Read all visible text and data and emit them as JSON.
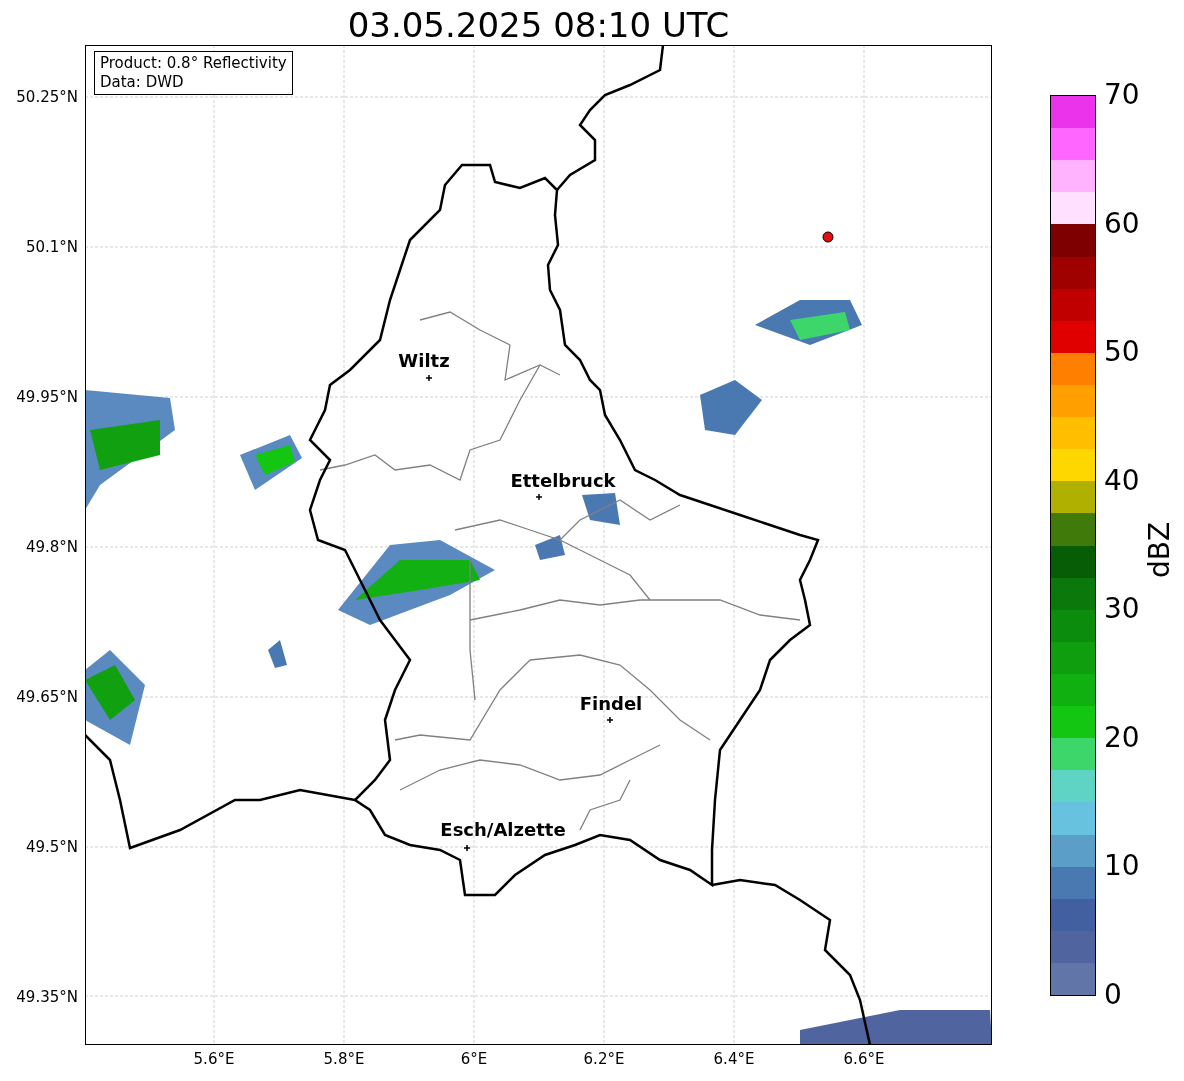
{
  "title": "03.05.2025 08:10 UTC",
  "info_box": [
    "Product: 0.8° Reflectivity",
    "Data: DWD"
  ],
  "y_ticks": [
    "50.25°N",
    "50.1°N",
    "49.95°N",
    "49.8°N",
    "49.65°N",
    "49.5°N",
    "49.35°N"
  ],
  "x_ticks": [
    "5.6°E",
    "5.8°E",
    "6°E",
    "6.2°E",
    "6.4°E",
    "6.6°E"
  ],
  "cities": [
    {
      "name": "Wiltz"
    },
    {
      "name": "Ettelbruck"
    },
    {
      "name": "Findel"
    },
    {
      "name": "Esch/Alzette"
    }
  ],
  "colorbar": {
    "label": "dBZ",
    "ticks": [
      "70",
      "60",
      "50",
      "40",
      "30",
      "20",
      "10",
      "0"
    ],
    "segments": [
      {
        "color": "#6275a8"
      },
      {
        "color": "#5065a0"
      },
      {
        "color": "#4260a0"
      },
      {
        "color": "#4a78b0"
      },
      {
        "color": "#5b9ec8"
      },
      {
        "color": "#66c2de"
      },
      {
        "color": "#60d4c4"
      },
      {
        "color": "#3dd66b"
      },
      {
        "color": "#12c612"
      },
      {
        "color": "#10b010"
      },
      {
        "color": "#0e9e0e"
      },
      {
        "color": "#0c8c0c"
      },
      {
        "color": "#0a780a"
      },
      {
        "color": "#065d06"
      },
      {
        "color": "#407a0a"
      },
      {
        "color": "#b0b000"
      },
      {
        "color": "#ffd700"
      },
      {
        "color": "#ffbf00"
      },
      {
        "color": "#ff9f00"
      },
      {
        "color": "#ff7f00"
      },
      {
        "color": "#e00000"
      },
      {
        "color": "#c00000"
      },
      {
        "color": "#9f0000"
      },
      {
        "color": "#7f0000"
      },
      {
        "color": "#ffe0ff"
      },
      {
        "color": "#ffb3ff"
      },
      {
        "color": "#ff66ff"
      },
      {
        "color": "#ea33ea"
      }
    ]
  }
}
